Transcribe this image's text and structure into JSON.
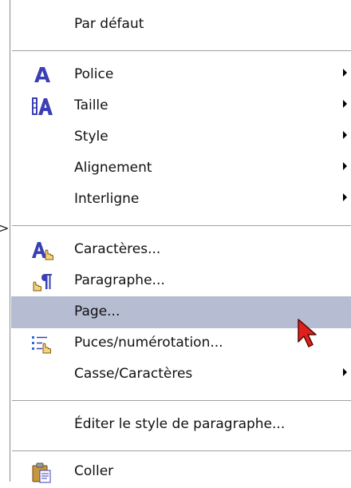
{
  "menu": {
    "items": [
      {
        "label": "Par défaut"
      },
      {
        "label": "Police",
        "icon": "font-icon",
        "submenu": true
      },
      {
        "label": "Taille",
        "icon": "font-size-icon",
        "submenu": true
      },
      {
        "label": "Style",
        "submenu": true
      },
      {
        "label": "Alignement",
        "submenu": true
      },
      {
        "label": "Interligne",
        "submenu": true
      },
      {
        "label": "Caractères...",
        "icon": "character-icon"
      },
      {
        "label": "Paragraphe...",
        "icon": "paragraph-icon"
      },
      {
        "label": "Page...",
        "highlighted": true
      },
      {
        "label": "Puces/numérotation...",
        "icon": "bullets-numbering-icon"
      },
      {
        "label": "Casse/Caractères",
        "submenu": true
      },
      {
        "label": "Éditer le style de paragraphe..."
      },
      {
        "label": "Coller",
        "icon": "paste-icon"
      }
    ]
  },
  "colors": {
    "highlight": "#b6bdd2",
    "icon_blue": "#3a3fb5",
    "cursor_red": "#e0201c"
  }
}
